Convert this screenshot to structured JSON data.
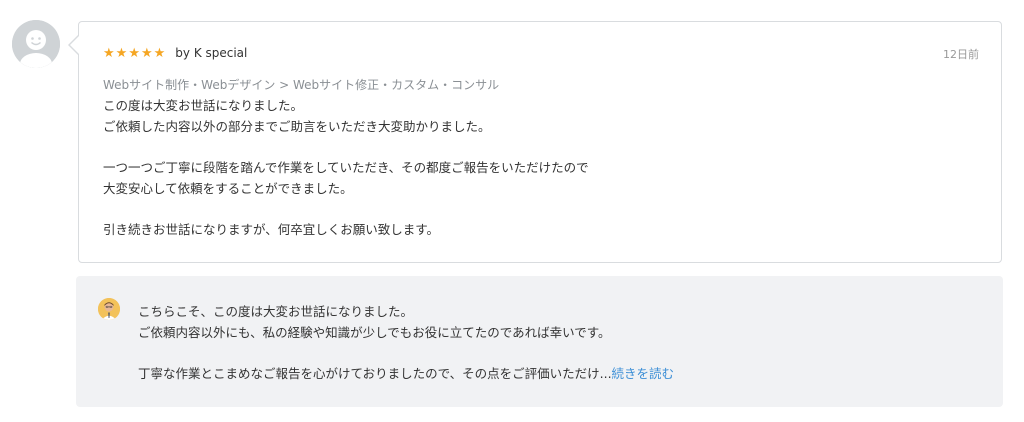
{
  "review": {
    "stars": [
      "★",
      "★",
      "★",
      "★",
      "★"
    ],
    "rating": 5,
    "reviewer": "by K special",
    "date": "12日前",
    "category": "Webサイト制作・Webデザイン > Webサイト修正・カスタム・コンサル",
    "body": {
      "line1": "この度は大変お世話になりました。",
      "line2": "ご依頼した内容以外の部分までご助言をいただき大変助かりました。",
      "line3": "一つ一つご丁寧に段階を踏んで作業をしていただき、その都度ご報告をいただけたので",
      "line4": "大変安心して依頼をすることができました。",
      "line5": "引き続きお世話になりますが、何卒宜しくお願い致します。"
    }
  },
  "reply": {
    "line1": "こちらこそ、この度は大変お世話になりました。",
    "line2": "ご依頼内容以外にも、私の経験や知識が少しでもお役に立てたのであれば幸いです。",
    "line3": "丁寧な作業とこまめなご報告を心がけておりましたので、その点をご評価いただけ...",
    "read_more": "続きを読む"
  },
  "colors": {
    "star": "#f5a623",
    "link": "#3d8fd6",
    "reply_bg": "#f1f2f4",
    "border": "#d9dcdf"
  }
}
